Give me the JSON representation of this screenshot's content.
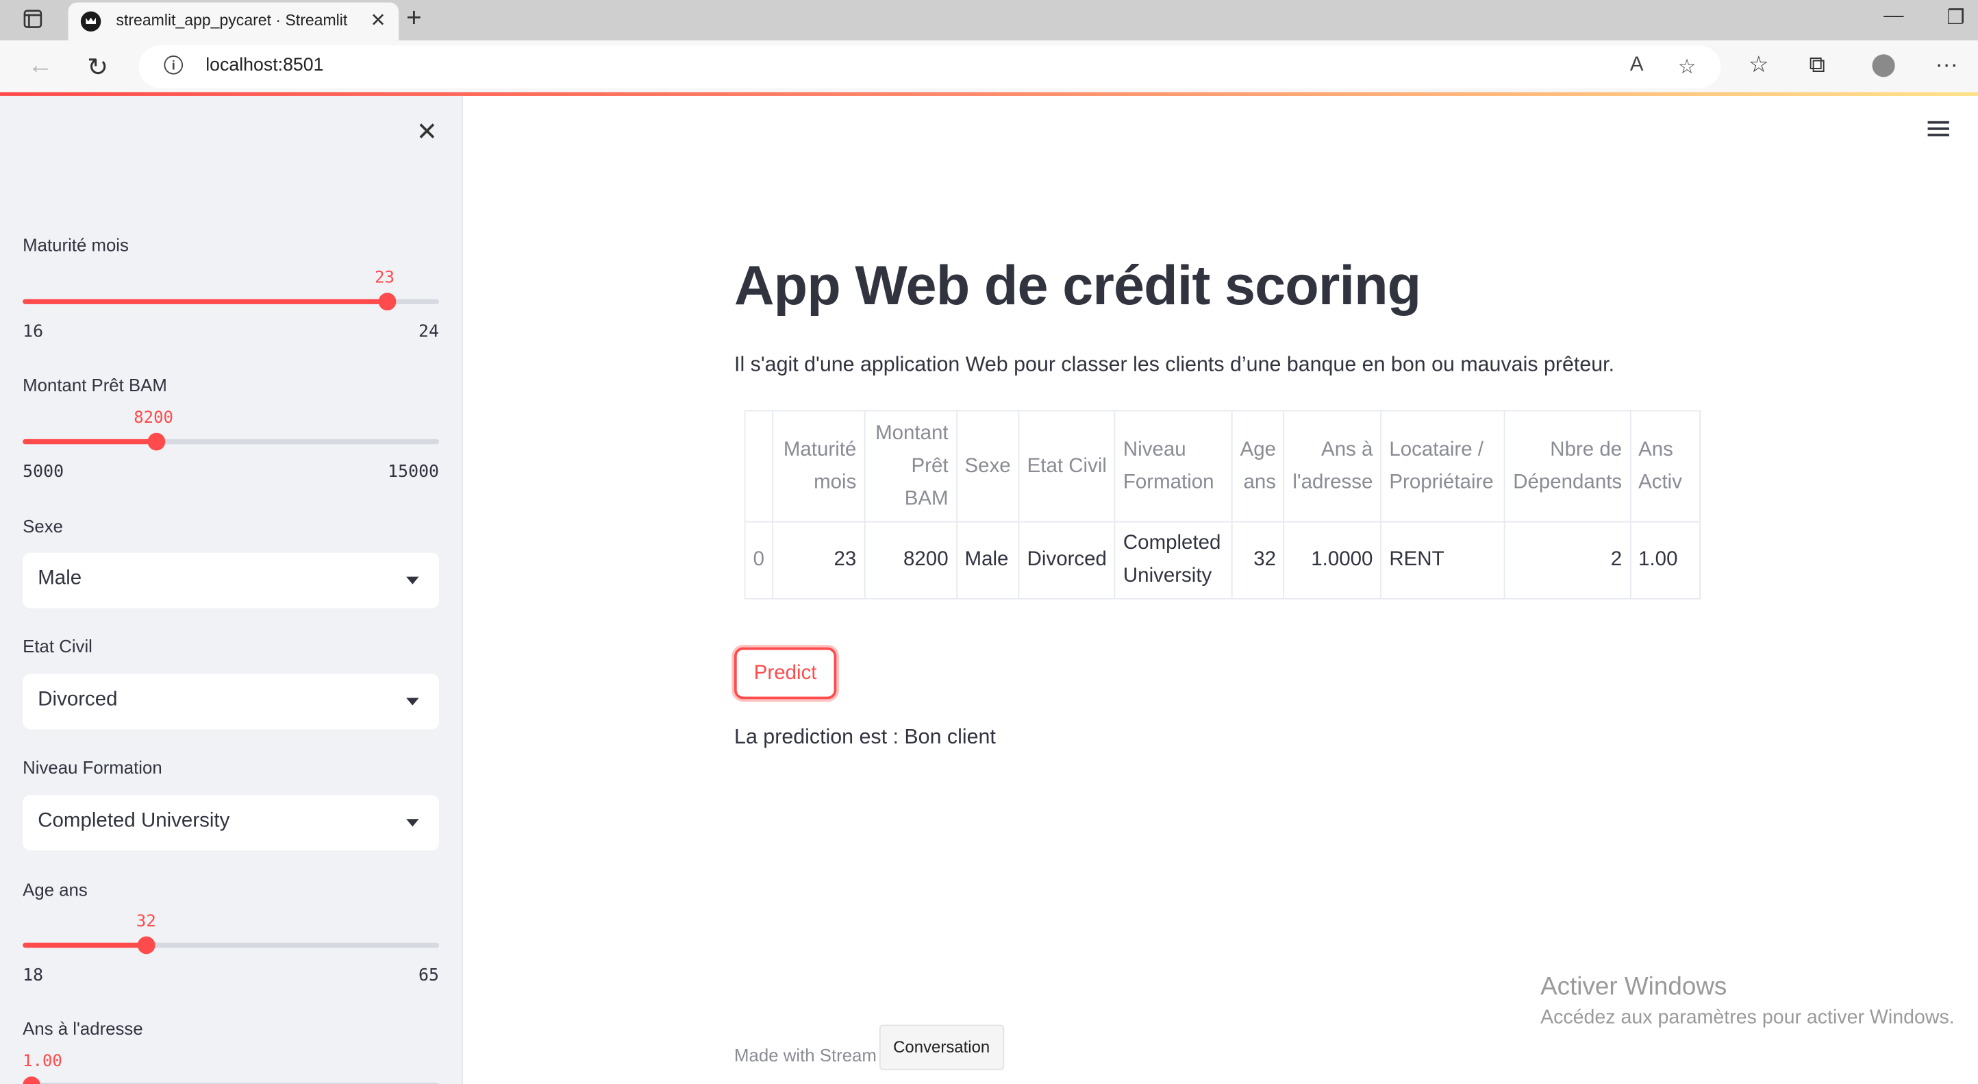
{
  "browser": {
    "tab_title": "streamlit_app_pycaret · Streamlit",
    "url": "localhost:8501"
  },
  "sidebar": {
    "sliders": [
      {
        "label": "Maturité mois",
        "value": "23",
        "min": "16",
        "max": "24",
        "fraction": 0.875
      },
      {
        "label": "Montant Prêt BAM",
        "value": "8200",
        "min": "5000",
        "max": "15000",
        "fraction": 0.32
      },
      {
        "label": "Age ans",
        "value": "32",
        "min": "18",
        "max": "65",
        "fraction": 0.298
      },
      {
        "label": "Ans à l'adresse",
        "value": "1.00",
        "fraction": 0.0
      }
    ],
    "selects": [
      {
        "label": "Sexe",
        "value": "Male"
      },
      {
        "label": "Etat Civil",
        "value": "Divorced"
      },
      {
        "label": "Niveau Formation",
        "value": "Completed University"
      }
    ]
  },
  "main": {
    "title": "App Web de crédit scoring",
    "subtitle": "Il s'agit d'une application Web pour classer les clients d’une banque en bon ou mauvais prêteur.",
    "table": {
      "headers": [
        "",
        "Maturité mois",
        "Montant Prêt BAM",
        "Sexe",
        "Etat Civil",
        "Niveau Formation",
        "Age ans",
        "Ans à l'adresse",
        "Locataire / Propriétaire",
        "Nbre de Dépendants",
        "Ans Activ"
      ],
      "row": [
        "0",
        "23",
        "8200",
        "Male",
        "Divorced",
        "Completed University",
        "32",
        "1.0000",
        "RENT",
        "2",
        "1.00"
      ]
    },
    "predict_label": "Predict",
    "prediction": "La prediction est : Bon client",
    "footer_text": "Made with Stream",
    "tooltip": "Conversation"
  },
  "watermark": {
    "line1": "Activer Windows",
    "line2": "Accédez aux paramètres pour activer Windows."
  },
  "colors": {
    "accent": "#ff4b4b",
    "sidebar_bg": "#f0f2f6",
    "text": "#31333f"
  }
}
